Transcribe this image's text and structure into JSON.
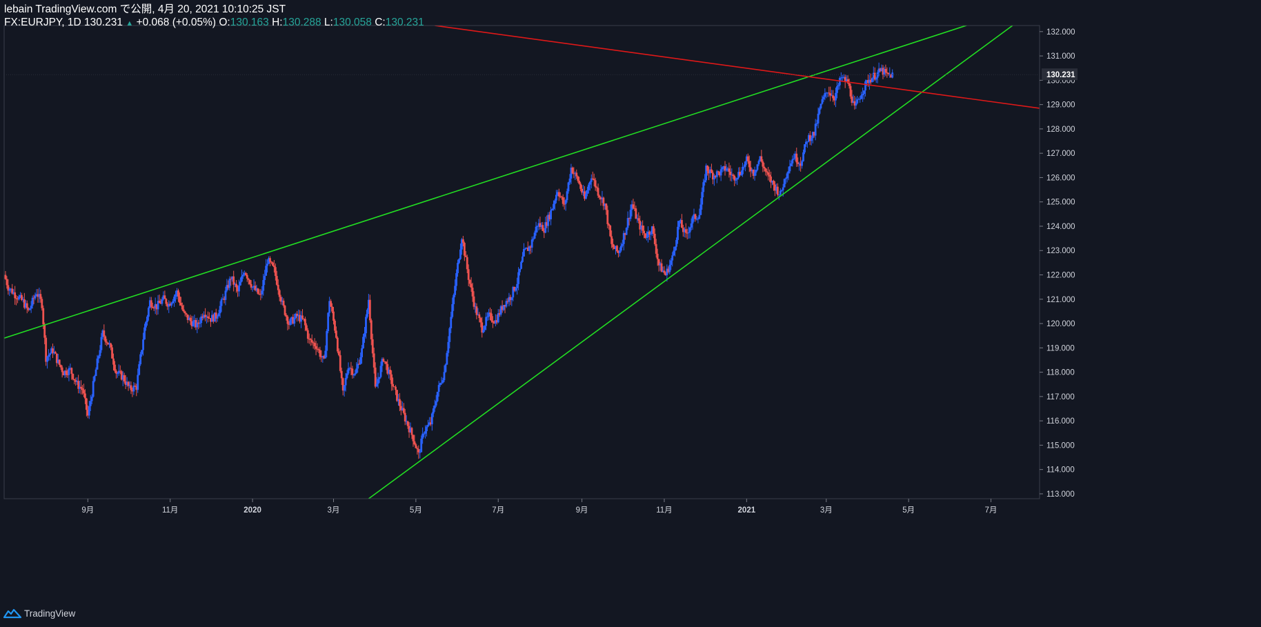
{
  "header": {
    "publish_line": "lebain TradingView.com で公開, 4月 20, 2021 10:10:25 JST",
    "symbol": "FX:EURJPY, 1D",
    "last": "130.231",
    "change": "+0.068 (+0.05%)",
    "o_label": "O:",
    "o_value": "130.163",
    "h_label": "H:",
    "h_value": "130.288",
    "l_label": "L:",
    "l_value": "130.058",
    "c_label": "C:",
    "c_value": "130.231"
  },
  "footer": {
    "brand": "TradingView"
  },
  "colors": {
    "background": "#131722",
    "up": "#2962ff",
    "down": "#ef5350",
    "trend_green": "#22dd22",
    "trend_red": "#e01818",
    "price_label_bg": "#2a2e39"
  },
  "chart_data": {
    "type": "candlestick",
    "symbol": "FX:EURJPY",
    "interval": "1D",
    "y_ticks": [
      "113.000",
      "114.000",
      "115.000",
      "116.000",
      "117.000",
      "118.000",
      "119.000",
      "120.000",
      "121.000",
      "122.000",
      "123.000",
      "124.000",
      "125.000",
      "126.000",
      "127.000",
      "128.000",
      "129.000",
      "130.000",
      "131.000",
      "132.000"
    ],
    "x_ticks": [
      {
        "label": "9月",
        "date": "2019-09-01"
      },
      {
        "label": "11月",
        "date": "2019-11-01"
      },
      {
        "label": "2020",
        "date": "2020-01-01"
      },
      {
        "label": "3月",
        "date": "2020-03-01"
      },
      {
        "label": "5月",
        "date": "2020-05-01"
      },
      {
        "label": "7月",
        "date": "2020-07-01"
      },
      {
        "label": "9月",
        "date": "2020-09-01"
      },
      {
        "label": "11月",
        "date": "2020-11-01"
      },
      {
        "label": "2021",
        "date": "2021-01-01"
      },
      {
        "label": "3月",
        "date": "2021-03-01"
      },
      {
        "label": "5月",
        "date": "2021-05-01"
      },
      {
        "label": "7月",
        "date": "2021-07-01"
      }
    ],
    "x_range": [
      "2019-07-01",
      "2021-08-06"
    ],
    "y_range": [
      112.8,
      132.25
    ],
    "last_price_label": "130.231",
    "closes": [
      [
        "2019-07-02",
        122.0
      ],
      [
        "2019-07-05",
        121.5
      ],
      [
        "2019-07-10",
        121.2
      ],
      [
        "2019-07-16",
        120.9
      ],
      [
        "2019-07-20",
        120.5
      ],
      [
        "2019-07-26",
        121.3
      ],
      [
        "2019-07-30",
        120.8
      ],
      [
        "2019-08-02",
        118.6
      ],
      [
        "2019-08-07",
        118.9
      ],
      [
        "2019-08-11",
        118.4
      ],
      [
        "2019-08-15",
        118.0
      ],
      [
        "2019-08-20",
        118.1
      ],
      [
        "2019-08-25",
        117.5
      ],
      [
        "2019-08-29",
        117.3
      ],
      [
        "2019-09-02",
        116.2
      ],
      [
        "2019-09-08",
        118.1
      ],
      [
        "2019-09-13",
        119.6
      ],
      [
        "2019-09-18",
        119.1
      ],
      [
        "2019-09-23",
        118.0
      ],
      [
        "2019-09-28",
        117.8
      ],
      [
        "2019-10-03",
        117.3
      ],
      [
        "2019-10-08",
        117.4
      ],
      [
        "2019-10-14",
        119.8
      ],
      [
        "2019-10-18",
        120.9
      ],
      [
        "2019-10-23",
        120.7
      ],
      [
        "2019-10-28",
        121.0
      ],
      [
        "2019-11-01",
        120.8
      ],
      [
        "2019-11-07",
        121.3
      ],
      [
        "2019-11-12",
        120.4
      ],
      [
        "2019-11-17",
        120.1
      ],
      [
        "2019-11-22",
        119.9
      ],
      [
        "2019-11-27",
        120.5
      ],
      [
        "2019-12-02",
        120.2
      ],
      [
        "2019-12-06",
        120.3
      ],
      [
        "2019-12-12",
        121.1
      ],
      [
        "2019-12-17",
        121.9
      ],
      [
        "2019-12-22",
        121.3
      ],
      [
        "2019-12-27",
        122.2
      ],
      [
        "2020-01-02",
        121.5
      ],
      [
        "2020-01-08",
        121.1
      ],
      [
        "2020-01-13",
        122.6
      ],
      [
        "2020-01-18",
        122.2
      ],
      [
        "2020-01-24",
        120.8
      ],
      [
        "2020-01-29",
        120.0
      ],
      [
        "2020-02-04",
        120.3
      ],
      [
        "2020-02-09",
        120.1
      ],
      [
        "2020-02-13",
        119.3
      ],
      [
        "2020-02-18",
        119.1
      ],
      [
        "2020-02-24",
        118.4
      ],
      [
        "2020-02-28",
        121.0
      ],
      [
        "2020-03-04",
        119.5
      ],
      [
        "2020-03-09",
        117.1
      ],
      [
        "2020-03-13",
        118.3
      ],
      [
        "2020-03-18",
        117.9
      ],
      [
        "2020-03-23",
        118.9
      ],
      [
        "2020-03-28",
        121.0
      ],
      [
        "2020-04-02",
        117.3
      ],
      [
        "2020-04-08",
        118.6
      ],
      [
        "2020-04-14",
        117.6
      ],
      [
        "2020-04-19",
        116.8
      ],
      [
        "2020-04-24",
        116.1
      ],
      [
        "2020-04-30",
        115.3
      ],
      [
        "2020-05-04",
        114.6
      ],
      [
        "2020-05-08",
        115.6
      ],
      [
        "2020-05-13",
        115.9
      ],
      [
        "2020-05-18",
        117.2
      ],
      [
        "2020-05-23",
        118.0
      ],
      [
        "2020-05-27",
        119.8
      ],
      [
        "2020-06-01",
        122.0
      ],
      [
        "2020-06-05",
        123.6
      ],
      [
        "2020-06-10",
        121.9
      ],
      [
        "2020-06-15",
        120.6
      ],
      [
        "2020-06-20",
        119.8
      ],
      [
        "2020-06-25",
        120.3
      ],
      [
        "2020-06-30",
        120.1
      ],
      [
        "2020-07-06",
        120.8
      ],
      [
        "2020-07-11",
        121.1
      ],
      [
        "2020-07-16",
        121.7
      ],
      [
        "2020-07-21",
        122.9
      ],
      [
        "2020-07-26",
        123.2
      ],
      [
        "2020-07-31",
        124.1
      ],
      [
        "2020-08-05",
        123.9
      ],
      [
        "2020-08-10",
        124.6
      ],
      [
        "2020-08-15",
        125.5
      ],
      [
        "2020-08-20",
        124.8
      ],
      [
        "2020-08-25",
        126.4
      ],
      [
        "2020-08-30",
        125.9
      ],
      [
        "2020-09-04",
        125.1
      ],
      [
        "2020-09-09",
        126.1
      ],
      [
        "2020-09-14",
        125.4
      ],
      [
        "2020-09-19",
        124.9
      ],
      [
        "2020-09-24",
        123.2
      ],
      [
        "2020-09-29",
        122.9
      ],
      [
        "2020-10-04",
        123.8
      ],
      [
        "2020-10-09",
        124.9
      ],
      [
        "2020-10-14",
        124.1
      ],
      [
        "2020-10-19",
        123.6
      ],
      [
        "2020-10-24",
        123.9
      ],
      [
        "2020-10-29",
        122.4
      ],
      [
        "2020-11-03",
        122.0
      ],
      [
        "2020-11-08",
        122.7
      ],
      [
        "2020-11-13",
        124.2
      ],
      [
        "2020-11-18",
        123.6
      ],
      [
        "2020-11-23",
        124.3
      ],
      [
        "2020-11-28",
        124.5
      ],
      [
        "2020-12-03",
        126.4
      ],
      [
        "2020-12-08",
        126.1
      ],
      [
        "2020-12-13",
        126.2
      ],
      [
        "2020-12-18",
        126.4
      ],
      [
        "2020-12-23",
        126.0
      ],
      [
        "2020-12-28",
        126.2
      ],
      [
        "2021-01-02",
        126.7
      ],
      [
        "2021-01-07",
        126.2
      ],
      [
        "2021-01-12",
        126.8
      ],
      [
        "2021-01-17",
        126.1
      ],
      [
        "2021-01-22",
        125.7
      ],
      [
        "2021-01-27",
        125.3
      ],
      [
        "2021-02-01",
        126.3
      ],
      [
        "2021-02-06",
        126.9
      ],
      [
        "2021-02-11",
        126.6
      ],
      [
        "2021-02-16",
        127.6
      ],
      [
        "2021-02-21",
        127.8
      ],
      [
        "2021-02-26",
        129.0
      ],
      [
        "2021-03-03",
        129.6
      ],
      [
        "2021-03-08",
        129.3
      ],
      [
        "2021-03-13",
        130.1
      ],
      [
        "2021-03-18",
        129.9
      ],
      [
        "2021-03-23",
        128.8
      ],
      [
        "2021-03-28",
        129.5
      ],
      [
        "2021-04-02",
        130.0
      ],
      [
        "2021-04-07",
        130.2
      ],
      [
        "2021-04-12",
        130.4
      ],
      [
        "2021-04-16",
        130.2
      ],
      [
        "2021-04-20",
        130.23
      ]
    ],
    "trendlines": [
      {
        "color": "green",
        "from": [
          "2019-07-01",
          119.4
        ],
        "to": [
          "2021-07-16",
          132.85
        ]
      },
      {
        "color": "green",
        "from": [
          "2020-03-27",
          112.8
        ],
        "to": [
          "2021-07-17",
          132.25
        ]
      },
      {
        "color": "red",
        "from": [
          "2020-05-15",
          132.25
        ],
        "to": [
          "2021-08-06",
          128.85
        ]
      }
    ]
  }
}
